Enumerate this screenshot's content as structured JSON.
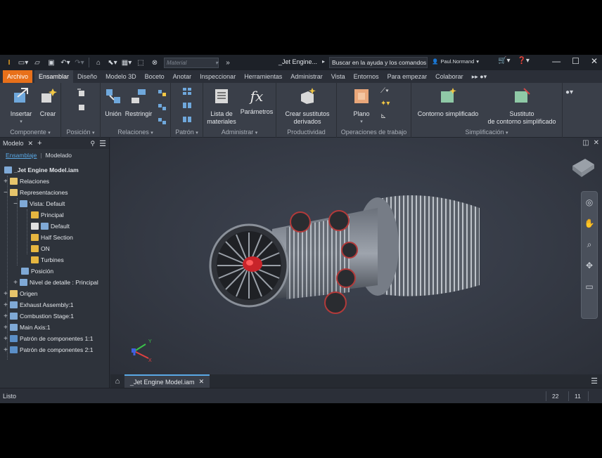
{
  "titlebar": {
    "material_placeholder": "Material",
    "document_title": "_Jet Engine...",
    "search_value": "Buscar en la ayuda y los comandos",
    "user_name": "Paul.Normand"
  },
  "tabs": [
    "Archivo",
    "Ensamblar",
    "Diseño",
    "Modelo 3D",
    "Boceto",
    "Anotar",
    "Inspeccionar",
    "Herramientas",
    "Administrar",
    "Vista",
    "Entornos",
    "Para empezar",
    "Colaborar"
  ],
  "active_tab": "Ensamblar",
  "ribbon": {
    "componente": {
      "label": "Componente",
      "insertar": "Insertar",
      "crear": "Crear"
    },
    "posicion": {
      "label": "Posición"
    },
    "relaciones": {
      "label": "Relaciones",
      "union": "Unión",
      "restringir": "Restringir"
    },
    "patron": {
      "label": "Patrón"
    },
    "administrar": {
      "label": "Administrar",
      "lista": "Lista de",
      "lista2": "materiales",
      "parametros": "Parámetros"
    },
    "productividad": {
      "label": "Productividad",
      "crear_sust": "Crear sustitutos",
      "crear_sust2": "derivados"
    },
    "operaciones": {
      "label": "Operaciones de trabajo",
      "plano": "Plano"
    },
    "simplificacion": {
      "label": "Simplificación",
      "contorno": "Contorno simplificado",
      "sustituto": "Sustituto",
      "sustituto2": "de contorno simplificado"
    }
  },
  "browser": {
    "title": "Modelo",
    "tab_ensamblaje": "Ensamblaje",
    "tab_modelado": "Modelado",
    "root": "_Jet Engine Model.iam",
    "items": {
      "relaciones": "Relaciones",
      "representaciones": "Representaciones",
      "vista": "Vista: Default",
      "principal": "Principal",
      "default": "Default",
      "half": "Half Section",
      "on": "ON",
      "turbines": "Turbines",
      "posicion": "Posición",
      "nivel": "Nivel de detalle : Principal",
      "origen": "Origen",
      "exhaust": "Exhaust Assembly:1",
      "combustion": "Combustion Stage:1",
      "mainaxis": "Main Axis:1",
      "patron1": "Patrón de componentes 1:1",
      "patron2": "Patrón de componentes 2:1"
    }
  },
  "document_tab": "_Jet Engine Model.iam",
  "status": {
    "text": "Listo",
    "n1": "22",
    "n2": "11"
  },
  "colors": {
    "accent": "#e8701a",
    "link": "#5aa9e6",
    "background": "#2b2f38"
  }
}
